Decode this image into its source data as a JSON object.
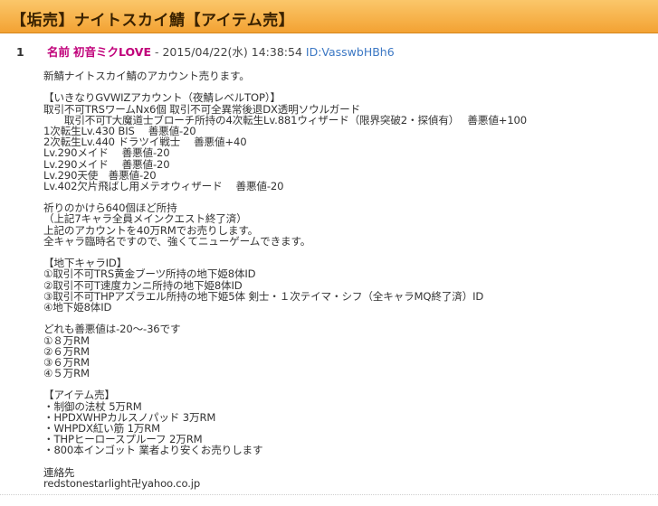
{
  "thread": {
    "title": "【垢売】ナイトスカイ鯖【アイテム売】"
  },
  "post": {
    "number": "1",
    "name_label": "名前",
    "author": "初音ミクLOVE",
    "separator": " - ",
    "date": "2015/04/22(水) 14:38:54",
    "id": "ID:VasswbHBh6",
    "body": [
      "新鯖ナイトスカイ鯖のアカウント売ります。",
      "",
      "【いきなりGVWIZアカウント（夜鯖レベルTOP）】",
      "取引不可TRSワームNx6個 取引不可全異常後退DX透明ソウルガード",
      "　　取引不可T大魔道士ブローチ所持の4次転生Lv.881ウィザード（限界突破2・探偵有）　 善悪値+100",
      "1次転生Lv.430 BIS　 善悪値-20",
      "2次転生Lv.440 ドラツイ戦士　 善悪値+40",
      "Lv.290メイド　 善悪値-20",
      "Lv.290メイド　 善悪値-20",
      "Lv.290天使　善悪値-20",
      "Lv.402欠片飛ばし用メテオウィザード　 善悪値-20",
      "",
      "祈りのかけら640個ほど所持",
      "（上記7キャラ全員メインクエスト終了済）",
      "上記のアカウントを40万RMでお売りします。",
      "全キャラ臨時名ですので、強くてニューゲームできます。",
      "",
      "【地下キャラID】",
      "①取引不可TRS黄金ブーツ所持の地下姫8体ID",
      "②取引不可T速度カンニ所持の地下姫8体ID",
      "③取引不可THPアズラエル所持の地下姫5体 剣士・１次テイマ・シフ（全キャラMQ終了済）ID",
      "④地下姫8体ID",
      "",
      "どれも善悪値は-20～-36です",
      "①８万RM",
      "②６万RM",
      "③６万RM",
      "④５万RM",
      "",
      "【アイテム売】",
      "・制御の法杖 5万RM",
      "・HPDXWHPカルスノパッド 3万RM",
      "・WHPDX紅い筋 1万RM",
      "・THPヒーロースプルーフ 2万RM",
      "・800本インゴット 業者より安くお売りします",
      "",
      "連絡先",
      "redstonestarlight卍yahoo.co.jp"
    ]
  }
}
